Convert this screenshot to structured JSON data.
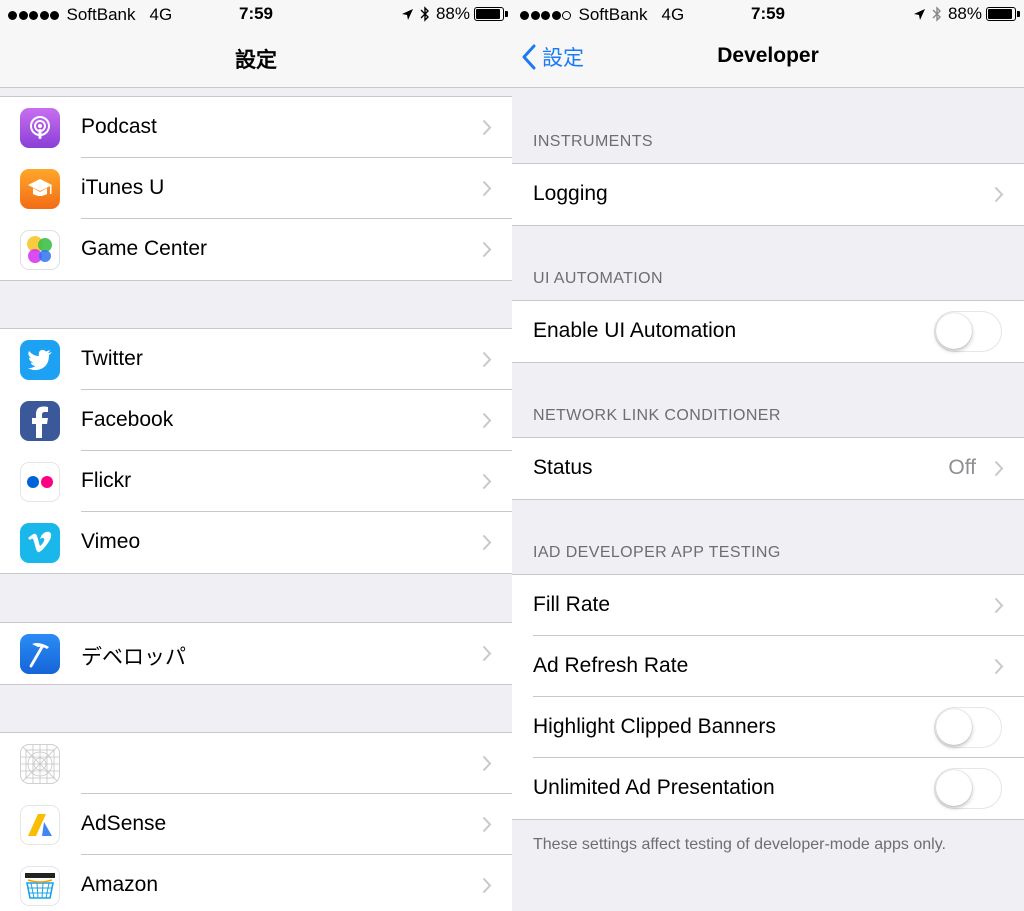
{
  "left": {
    "status": {
      "carrier": "SoftBank",
      "network": "4G",
      "time": "7:59",
      "battery": "88%",
      "signal_bars": 5
    },
    "nav": {
      "title": "設定"
    },
    "groups": [
      [
        {
          "label": "Podcast",
          "icon": "podcast-icon"
        },
        {
          "label": "iTunes U",
          "icon": "itunes-u-icon"
        },
        {
          "label": "Game Center",
          "icon": "game-center-icon"
        }
      ],
      [
        {
          "label": "Twitter",
          "icon": "twitter-icon"
        },
        {
          "label": "Facebook",
          "icon": "facebook-icon"
        },
        {
          "label": "Flickr",
          "icon": "flickr-icon"
        },
        {
          "label": "Vimeo",
          "icon": "vimeo-icon"
        }
      ],
      [
        {
          "label": "デベロッパ",
          "icon": "developer-hammer-icon"
        }
      ],
      [
        {
          "label": "",
          "icon": "placeholder-app-icon"
        },
        {
          "label": "AdSense",
          "icon": "adsense-icon"
        },
        {
          "label": "Amazon",
          "icon": "amazon-icon"
        }
      ]
    ]
  },
  "right": {
    "status": {
      "carrier": "SoftBank",
      "network": "4G",
      "time": "7:59",
      "battery": "88%",
      "signal_bars": 4
    },
    "nav": {
      "back_label": "設定",
      "title": "Developer"
    },
    "sections": {
      "instruments": {
        "header": "INSTRUMENTS",
        "logging": "Logging"
      },
      "ui_automation": {
        "header": "UI AUTOMATION",
        "enable": "Enable UI Automation",
        "enable_on": false
      },
      "nlc": {
        "header": "NETWORK LINK CONDITIONER",
        "status": "Status",
        "status_value": "Off"
      },
      "iad": {
        "header": "IAD DEVELOPER APP TESTING",
        "fill_rate": "Fill Rate",
        "ad_refresh": "Ad Refresh Rate",
        "highlight": "Highlight Clipped Banners",
        "highlight_on": false,
        "unlimited": "Unlimited Ad Presentation",
        "unlimited_on": false,
        "footer": "These settings affect testing of developer-mode apps only."
      }
    }
  },
  "colors": {
    "tint": "#1a7bf5",
    "separator": "#c8c7cc",
    "group_bg": "#efeff4",
    "secondary_text": "#8e8e93"
  }
}
